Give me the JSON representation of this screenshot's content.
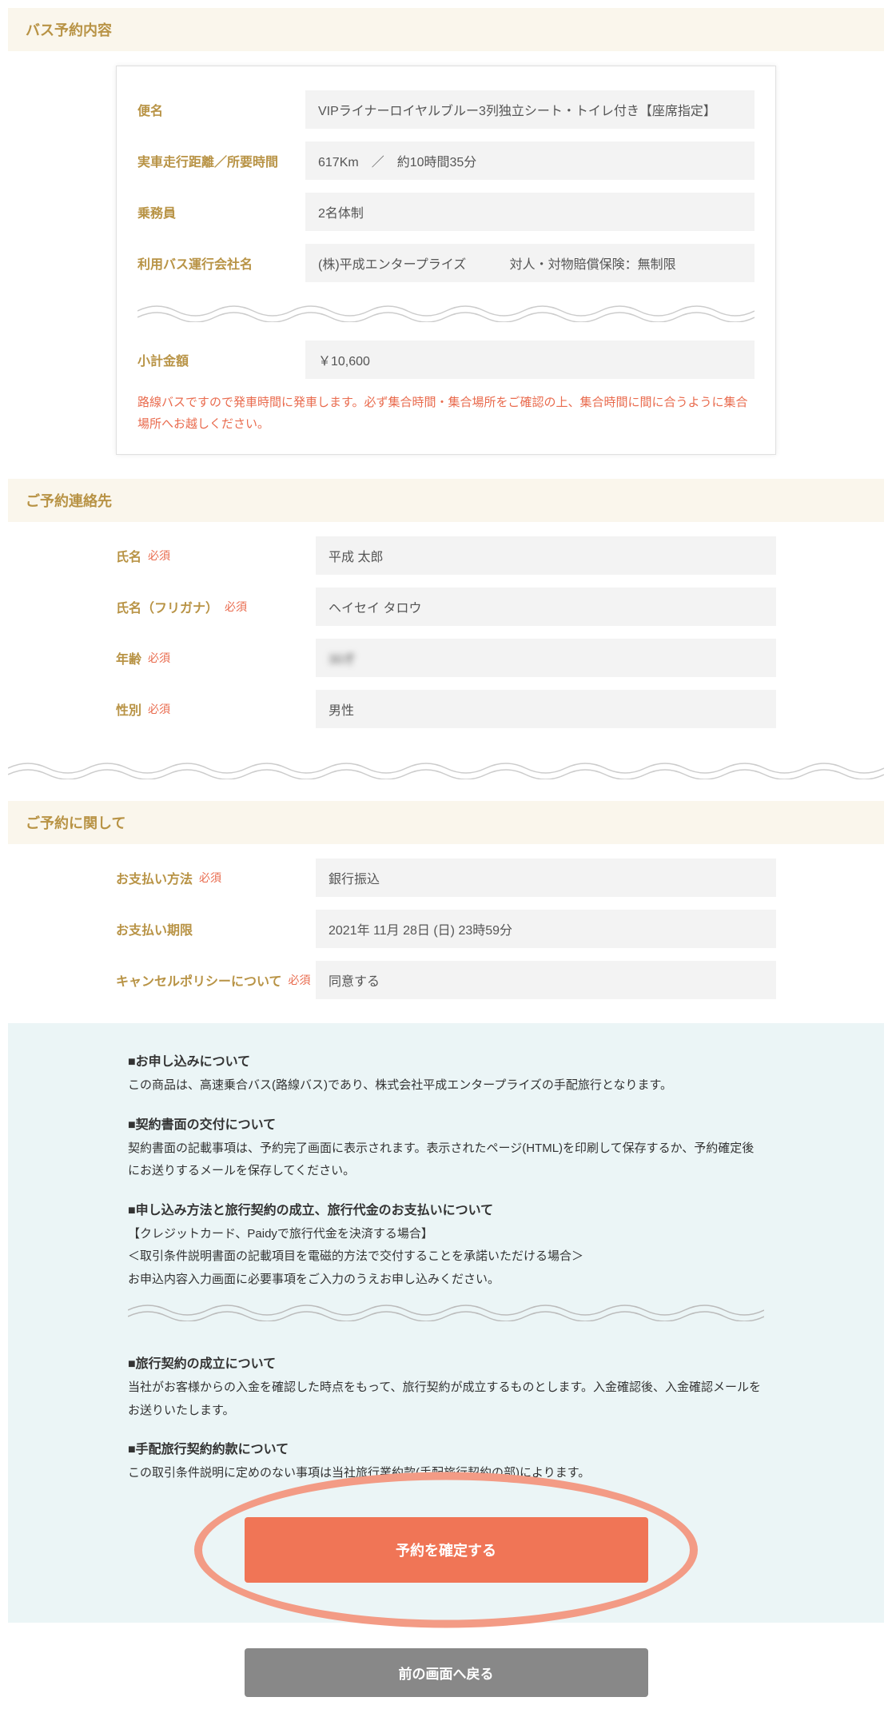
{
  "section1": {
    "title": "バス予約内容",
    "rows": {
      "bin_label": "便名",
      "bin_value": "VIPライナーロイヤルブルー3列独立シート・トイレ付き【座席指定】",
      "dist_label": "実車走行距離／所要時間",
      "dist_value": "617Km　／　約10時間35分",
      "crew_label": "乗務員",
      "crew_value": "2名体制",
      "company_label": "利用バス運行会社名",
      "company_value": "(株)平成エンタープライズ",
      "insurance": "対人・対物賠償保険：無制限",
      "subtotal_label": "小計金額",
      "subtotal_value": "￥10,600"
    },
    "notice": "路線バスですので発車時間に発車します。必ず集合時間・集合場所をご確認の上、集合時間に間に合うように集合場所へお越しください。"
  },
  "section2": {
    "title": "ご予約連絡先",
    "req": "必須",
    "name_label": "氏名",
    "name_value": "平成 太郎",
    "kana_label": "氏名（フリガナ）",
    "kana_value": "ヘイセイ タロウ",
    "age_label": "年齢",
    "age_value": "30才",
    "sex_label": "性別",
    "sex_value": "男性"
  },
  "section3": {
    "title": "ご予約に関して",
    "req": "必須",
    "pay_label": "お支払い方法",
    "pay_value": "銀行振込",
    "due_label": "お支払い期限",
    "due_value": "2021年 11月 28日 (日) 23時59分",
    "cancel_label": "キャンセルポリシーについて",
    "cancel_value": "同意する"
  },
  "info": {
    "h1": "■お申し込みについて",
    "p1": "この商品は、高速乗合バス(路線バス)であり、株式会社平成エンタープライズの手配旅行となります。",
    "h2": "■契約書面の交付について",
    "p2": "契約書面の記載事項は、予約完了画面に表示されます。表示されたページ(HTML)を印刷して保存するか、予約確定後にお送りするメールを保存してください。",
    "h3": "■申し込み方法と旅行契約の成立、旅行代金のお支払いについて",
    "p3a": "【クレジットカード、Paidyで旅行代金を決済する場合】",
    "p3b": "＜取引条件説明書面の記載項目を電磁的方法で交付することを承諾いただける場合＞",
    "p3c": "お申込内容入力画面に必要事項をご入力のうえお申し込みください。",
    "h4": "■旅行契約の成立について",
    "p4": "当社がお客様からの入金を確認した時点をもって、旅行契約が成立するものとします。入金確認後、入金確認メールをお送りいたします。",
    "h5": "■手配旅行契約約款について",
    "p5": "この取引条件説明に定めのない事項は当社旅行業約款(手配旅行契約の部)によります。"
  },
  "buttons": {
    "confirm": "予約を確定する",
    "back": "前の画面へ戻る"
  }
}
